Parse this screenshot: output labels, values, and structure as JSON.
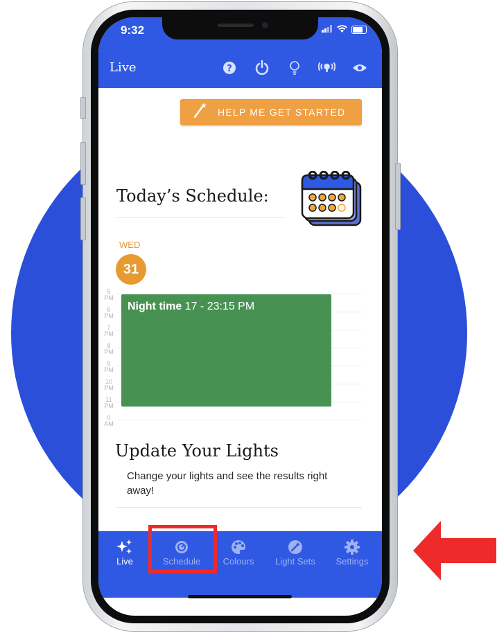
{
  "status_bar": {
    "time": "9:32"
  },
  "app_bar": {
    "title": "Live",
    "icons": [
      "help-icon",
      "power-icon",
      "bulb-icon",
      "broadcast-icon",
      "eye-icon"
    ]
  },
  "help_button": {
    "label": "HELP ME GET STARTED",
    "icon": "magic-wand-icon"
  },
  "schedule": {
    "title": "Today’s Schedule:",
    "day_name": "WED",
    "day_number": "31",
    "hours": [
      {
        "num": "5",
        "ampm": "PM"
      },
      {
        "num": "6",
        "ampm": "PM"
      },
      {
        "num": "7",
        "ampm": "PM"
      },
      {
        "num": "8",
        "ampm": "PM"
      },
      {
        "num": "9",
        "ampm": "PM"
      },
      {
        "num": "10",
        "ampm": "PM"
      },
      {
        "num": "11",
        "ampm": "PM"
      },
      {
        "num": "0",
        "ampm": "AM"
      }
    ],
    "event": {
      "name": "Night time",
      "time": "17 - 23:15 PM",
      "color": "#479253"
    }
  },
  "update": {
    "title": "Update Your Lights",
    "description": "Change your lights and see the results right away!"
  },
  "bottom_nav": [
    {
      "label": "Live",
      "icon": "sparkles-icon",
      "active": true
    },
    {
      "label": "Schedule",
      "icon": "timer-icon",
      "active": false
    },
    {
      "label": "Colours",
      "icon": "palette-icon",
      "active": false
    },
    {
      "label": "Light Sets",
      "icon": "wand-sets-icon",
      "active": false
    },
    {
      "label": "Settings",
      "icon": "gear-icon",
      "active": false
    }
  ],
  "colors": {
    "app_blue": "#2f59e3",
    "accent_orange": "#efa042",
    "highlight_red": "#ee2a2a",
    "background_blue": "#2b4fd8"
  }
}
